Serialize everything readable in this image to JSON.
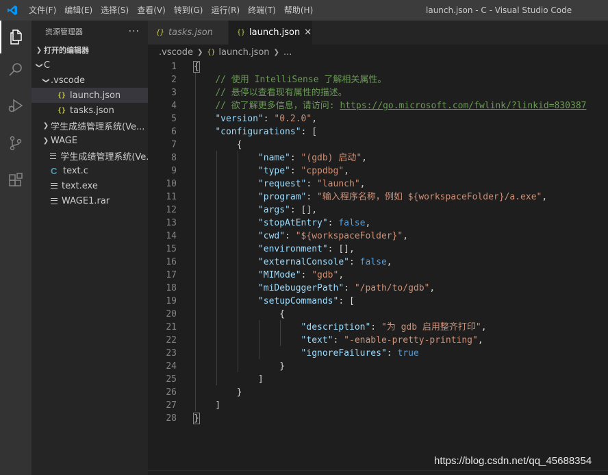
{
  "titlebar": {
    "menus": [
      "文件(F)",
      "编辑(E)",
      "选择(S)",
      "查看(V)",
      "转到(G)",
      "运行(R)",
      "终端(T)",
      "帮助(H)"
    ],
    "window_title": "launch.json - C - Visual Studio Code"
  },
  "activitybar": {
    "icons": [
      "explorer-icon",
      "search-icon",
      "run-debug-icon",
      "source-control-icon",
      "extensions-icon"
    ]
  },
  "sidebar": {
    "title": "资源管理器",
    "more": "···",
    "open_editors": "打开的编辑器",
    "tree": [
      {
        "label": "C",
        "chevron": "v",
        "icon": "",
        "indent": 0
      },
      {
        "label": ".vscode",
        "chevron": "v",
        "icon": "",
        "indent": 1
      },
      {
        "label": "launch.json",
        "chevron": "",
        "icon": "{}",
        "indent": 2,
        "selected": true
      },
      {
        "label": "tasks.json",
        "chevron": "",
        "icon": "{}",
        "indent": 2
      },
      {
        "label": "学生成绩管理系统(Ve...",
        "chevron": ">",
        "icon": "",
        "indent": 1
      },
      {
        "label": "WAGE",
        "chevron": ">",
        "icon": "",
        "indent": 1
      },
      {
        "label": "学生成绩管理系统(Ve...",
        "chevron": "",
        "icon": "lines",
        "indent": 1
      },
      {
        "label": "text.c",
        "chevron": "",
        "icon": "C",
        "indent": 1
      },
      {
        "label": "text.exe",
        "chevron": "",
        "icon": "lines",
        "indent": 1
      },
      {
        "label": "WAGE1.rar",
        "chevron": "",
        "icon": "lines",
        "indent": 1
      }
    ]
  },
  "tabs": [
    {
      "label": "tasks.json",
      "icon": "{}",
      "active": false
    },
    {
      "label": "launch.json",
      "icon": "{}",
      "active": true,
      "close": "✕"
    }
  ],
  "breadcrumb": {
    "folder": ".vscode",
    "file": "launch.json",
    "more": "..."
  },
  "editor": {
    "lines": [
      [
        [
          "{",
          "t-punc"
        ]
      ],
      [
        [
          "    ",
          "t-punc"
        ],
        [
          "// 使用 IntelliSense 了解相关属性。",
          "t-com"
        ]
      ],
      [
        [
          "    ",
          "t-punc"
        ],
        [
          "// 悬停以查看现有属性的描述。",
          "t-com"
        ]
      ],
      [
        [
          "    ",
          "t-punc"
        ],
        [
          "// 欲了解更多信息，请访问: ",
          "t-com"
        ],
        [
          "https://go.microsoft.com/fwlink/?linkid=830387",
          "t-link"
        ]
      ],
      [
        [
          "    ",
          "t-punc"
        ],
        [
          "\"version\"",
          "t-key"
        ],
        [
          ": ",
          "t-punc"
        ],
        [
          "\"0.2.0\"",
          "t-str"
        ],
        [
          ",",
          "t-punc"
        ]
      ],
      [
        [
          "    ",
          "t-punc"
        ],
        [
          "\"configurations\"",
          "t-key"
        ],
        [
          ": [",
          "t-punc"
        ]
      ],
      [
        [
          "        {",
          "t-punc"
        ]
      ],
      [
        [
          "            ",
          "t-punc"
        ],
        [
          "\"name\"",
          "t-key"
        ],
        [
          ": ",
          "t-punc"
        ],
        [
          "\"(gdb) 启动\"",
          "t-str"
        ],
        [
          ",",
          "t-punc"
        ]
      ],
      [
        [
          "            ",
          "t-punc"
        ],
        [
          "\"type\"",
          "t-key"
        ],
        [
          ": ",
          "t-punc"
        ],
        [
          "\"cppdbg\"",
          "t-str"
        ],
        [
          ",",
          "t-punc"
        ]
      ],
      [
        [
          "            ",
          "t-punc"
        ],
        [
          "\"request\"",
          "t-key"
        ],
        [
          ": ",
          "t-punc"
        ],
        [
          "\"launch\"",
          "t-str"
        ],
        [
          ",",
          "t-punc"
        ]
      ],
      [
        [
          "            ",
          "t-punc"
        ],
        [
          "\"program\"",
          "t-key"
        ],
        [
          ": ",
          "t-punc"
        ],
        [
          "\"输入程序名称，例如 ${workspaceFolder}/a.exe\"",
          "t-str"
        ],
        [
          ",",
          "t-punc"
        ]
      ],
      [
        [
          "            ",
          "t-punc"
        ],
        [
          "\"args\"",
          "t-key"
        ],
        [
          ": [],",
          "t-punc"
        ]
      ],
      [
        [
          "            ",
          "t-punc"
        ],
        [
          "\"stopAtEntry\"",
          "t-key"
        ],
        [
          ": ",
          "t-punc"
        ],
        [
          "false",
          "t-bool"
        ],
        [
          ",",
          "t-punc"
        ]
      ],
      [
        [
          "            ",
          "t-punc"
        ],
        [
          "\"cwd\"",
          "t-key"
        ],
        [
          ": ",
          "t-punc"
        ],
        [
          "\"${workspaceFolder}\"",
          "t-str"
        ],
        [
          ",",
          "t-punc"
        ]
      ],
      [
        [
          "            ",
          "t-punc"
        ],
        [
          "\"environment\"",
          "t-key"
        ],
        [
          ": [],",
          "t-punc"
        ]
      ],
      [
        [
          "            ",
          "t-punc"
        ],
        [
          "\"externalConsole\"",
          "t-key"
        ],
        [
          ": ",
          "t-punc"
        ],
        [
          "false",
          "t-bool"
        ],
        [
          ",",
          "t-punc"
        ]
      ],
      [
        [
          "            ",
          "t-punc"
        ],
        [
          "\"MIMode\"",
          "t-key"
        ],
        [
          ": ",
          "t-punc"
        ],
        [
          "\"gdb\"",
          "t-str"
        ],
        [
          ",",
          "t-punc"
        ]
      ],
      [
        [
          "            ",
          "t-punc"
        ],
        [
          "\"miDebuggerPath\"",
          "t-key"
        ],
        [
          ": ",
          "t-punc"
        ],
        [
          "\"/path/to/gdb\"",
          "t-str"
        ],
        [
          ",",
          "t-punc"
        ]
      ],
      [
        [
          "            ",
          "t-punc"
        ],
        [
          "\"setupCommands\"",
          "t-key"
        ],
        [
          ": [",
          "t-punc"
        ]
      ],
      [
        [
          "                {",
          "t-punc"
        ]
      ],
      [
        [
          "                    ",
          "t-punc"
        ],
        [
          "\"description\"",
          "t-key"
        ],
        [
          ": ",
          "t-punc"
        ],
        [
          "\"为 gdb 启用整齐打印\"",
          "t-str"
        ],
        [
          ",",
          "t-punc"
        ]
      ],
      [
        [
          "                    ",
          "t-punc"
        ],
        [
          "\"text\"",
          "t-key"
        ],
        [
          ": ",
          "t-punc"
        ],
        [
          "\"-enable-pretty-printing\"",
          "t-str"
        ],
        [
          ",",
          "t-punc"
        ]
      ],
      [
        [
          "                    ",
          "t-punc"
        ],
        [
          "\"ignoreFailures\"",
          "t-key"
        ],
        [
          ": ",
          "t-punc"
        ],
        [
          "true",
          "t-bool"
        ]
      ],
      [
        [
          "                }",
          "t-punc"
        ]
      ],
      [
        [
          "            ]",
          "t-punc"
        ]
      ],
      [
        [
          "        }",
          "t-punc"
        ]
      ],
      [
        [
          "    ]",
          "t-punc"
        ]
      ],
      [
        [
          "}",
          "t-punc"
        ]
      ]
    ]
  },
  "watermark": "https://blog.csdn.net/qq_45688354",
  "colors": {
    "titlebar": "#3c3c3c",
    "activitybar": "#333333",
    "sidebar": "#252526",
    "editor": "#1e1e1e",
    "accent": "#007acc"
  }
}
